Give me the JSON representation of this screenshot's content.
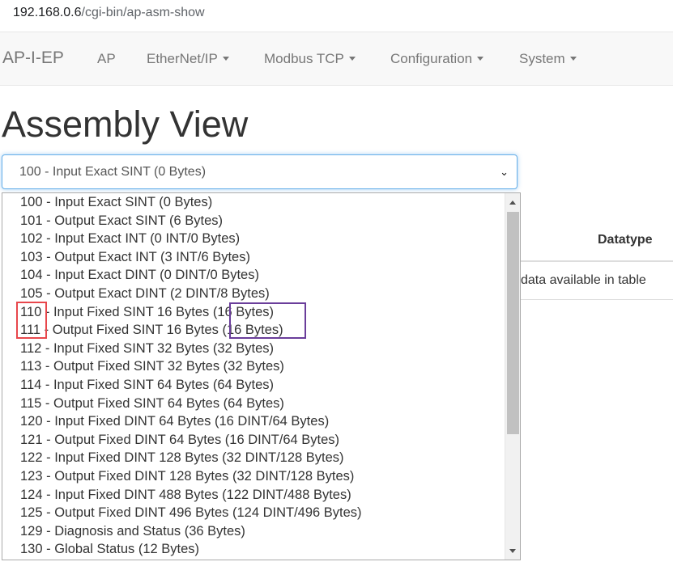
{
  "browser": {
    "url_host": "192.168.0.6",
    "url_path": "/cgi-bin/ap-asm-show"
  },
  "navbar": {
    "brand": "AP-I-EP",
    "items": [
      {
        "label": "AP",
        "dropdown": false
      },
      {
        "label": "EtherNet/IP",
        "dropdown": true
      },
      {
        "label": "Modbus TCP",
        "dropdown": true
      },
      {
        "label": "Configuration",
        "dropdown": true
      },
      {
        "label": "System",
        "dropdown": true
      }
    ]
  },
  "page": {
    "title": "Assembly View"
  },
  "assembly_select": {
    "selected": "100 - Input Exact SINT (0 Bytes)",
    "options": [
      "100 - Input Exact SINT (0 Bytes)",
      "101 - Output Exact SINT (6 Bytes)",
      "102 - Input Exact INT (0 INT/0 Bytes)",
      "103 - Output Exact INT (3 INT/6 Bytes)",
      "104 - Input Exact DINT (0 DINT/0 Bytes)",
      "105 - Output Exact DINT (2 DINT/8 Bytes)",
      "110 - Input Fixed SINT 16 Bytes (16 Bytes)",
      "111 - Output Fixed SINT 16 Bytes (16 Bytes)",
      "112 - Input Fixed SINT 32 Bytes (32 Bytes)",
      "113 - Output Fixed SINT 32 Bytes (32 Bytes)",
      "114 - Input Fixed SINT 64 Bytes (64 Bytes)",
      "115 - Output Fixed SINT 64 Bytes (64 Bytes)",
      "120 - Input Fixed DINT 64 Bytes (16 DINT/64 Bytes)",
      "121 - Output Fixed DINT 64 Bytes (16 DINT/64 Bytes)",
      "122 - Input Fixed DINT 128 Bytes (32 DINT/128 Bytes)",
      "123 - Output Fixed DINT 128 Bytes (32 DINT/128 Bytes)",
      "124 - Input Fixed DINT 488 Bytes (122 DINT/488 Bytes)",
      "125 - Output Fixed DINT 496 Bytes (124 DINT/496 Bytes)",
      "129 - Diagnosis and Status (36 Bytes)",
      "130 - Global Status (12 Bytes)"
    ]
  },
  "table": {
    "visible_header": "Datatype",
    "empty_message": "data available in table"
  },
  "colors": {
    "highlight_red": "#e8474c",
    "highlight_purple": "#6a3d9a",
    "focus_blue": "#66afe9"
  }
}
